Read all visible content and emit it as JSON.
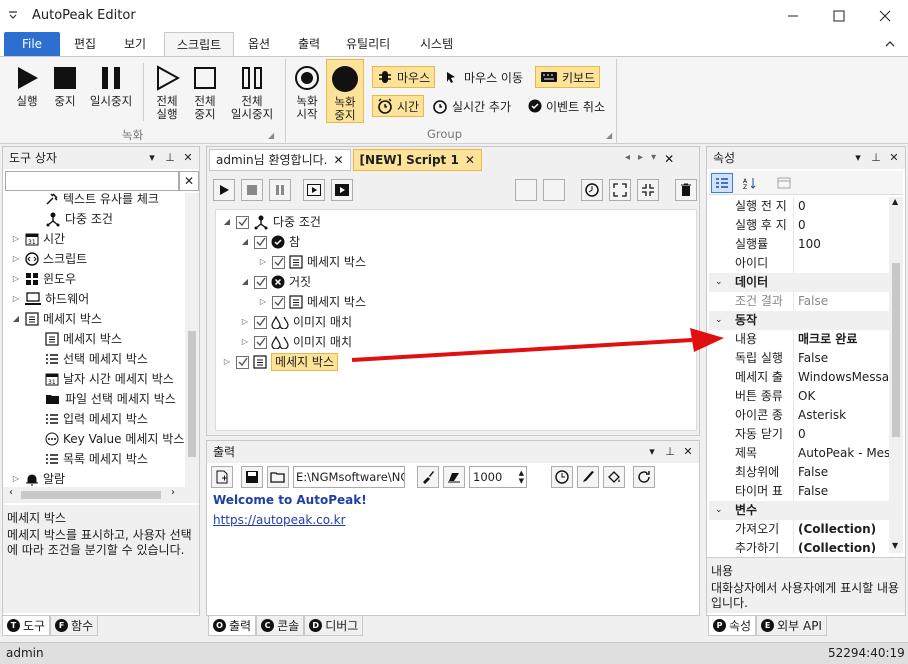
{
  "app": {
    "title": "AutoPeak Editor"
  },
  "menu": {
    "file": "File",
    "tabs": [
      "편집",
      "보기",
      "스크립트",
      "옵션",
      "출력",
      "유틸리티",
      "시스템"
    ]
  },
  "ribbon": {
    "record": [
      "실행",
      "중지",
      "일시중지"
    ],
    "all": [
      [
        "전체",
        "실행"
      ],
      [
        "전체",
        "중지"
      ],
      [
        "전체",
        "일시중지"
      ]
    ],
    "rec": [
      [
        "녹화",
        "시작"
      ],
      [
        "녹화",
        "중지"
      ]
    ],
    "small": {
      "mouse": "마우스",
      "mouse_move": "마우스 이동",
      "keyboard": "키보드",
      "time": "시간",
      "realtime": "실시간 추가",
      "event_cancel": "이벤트 취소"
    },
    "group_record": "녹화",
    "group_group": "Group"
  },
  "toolbox": {
    "title": "도구 상자",
    "items": [
      {
        "t": "텍스트 유사를 체크",
        "i": "similar"
      },
      {
        "t": "다중 조건",
        "i": "multi"
      },
      {
        "t": "시간",
        "i": "cal",
        "e": "▷"
      },
      {
        "t": "스크립트",
        "i": "script",
        "e": "▷"
      },
      {
        "t": "윈도우",
        "i": "win",
        "e": "▷"
      },
      {
        "t": "하드웨어",
        "i": "pc",
        "e": "▷"
      },
      {
        "t": "메세지 박스",
        "i": "msg",
        "e": "◢"
      },
      {
        "t": "메세지 박스",
        "i": "msg",
        "c": 1
      },
      {
        "t": "선택 메세지 박스",
        "i": "list",
        "c": 1
      },
      {
        "t": "날자 시간 메세지 박스",
        "i": "cal",
        "c": 1
      },
      {
        "t": "파일 선택 메세지 박스",
        "i": "folder",
        "c": 1
      },
      {
        "t": "입력 메세지 박스",
        "i": "list",
        "c": 1
      },
      {
        "t": "Key Value 메세지 박스",
        "i": "dots",
        "c": 1
      },
      {
        "t": "목록 메세지 박스",
        "i": "list",
        "c": 1
      },
      {
        "t": "알람",
        "i": "bell",
        "e": "▷"
      }
    ],
    "desc_title": "메세지 박스",
    "desc": "메세지 박스를 표시하고, 사용자 선택에 따라 조건을 분기할 수 있습니다.",
    "tabs": [
      "도구",
      "함수"
    ]
  },
  "doc": {
    "tabs": [
      "admin님 환영합니다.",
      "[NEW] Script 1"
    ]
  },
  "script": [
    {
      "t": "다중 조건",
      "l": 0,
      "e": "◢",
      "i": "multi"
    },
    {
      "t": "참",
      "l": 1,
      "e": "◢",
      "i": "check"
    },
    {
      "t": "메세지 박스",
      "l": 2,
      "e": "▷",
      "i": "msg"
    },
    {
      "t": "거짓",
      "l": 1,
      "e": "◢",
      "i": "x"
    },
    {
      "t": "메세지 박스",
      "l": 2,
      "e": "▷",
      "i": "msg"
    },
    {
      "t": "이미지 매치",
      "l": 1,
      "e": "▷",
      "i": "drops"
    },
    {
      "t": "이미지 매치",
      "l": 1,
      "e": "▷",
      "i": "drops"
    },
    {
      "t": "메세지 박스",
      "l": 0,
      "e": "▷",
      "i": "msg",
      "sel": 1
    }
  ],
  "output": {
    "title": "출력",
    "path": "E:\\NGMsoftware\\NG",
    "count": "1000",
    "welcome": "Welcome to AutoPeak!",
    "link": "https://autopeak.co.kr",
    "tabs": [
      "출력",
      "콘솔",
      "디버그"
    ]
  },
  "props": {
    "title": "속성",
    "rows": [
      {
        "k": "실행 전 지",
        "v": "0"
      },
      {
        "k": "실행 후 지",
        "v": "0"
      },
      {
        "k": "실행률",
        "v": "100"
      },
      {
        "k": "아이디",
        "v": ""
      },
      {
        "cat": "데이터"
      },
      {
        "k": "조건 결과",
        "v": "False",
        "g": 1
      },
      {
        "cat": "동작"
      },
      {
        "k": "내용",
        "v": "매크로 완료",
        "b": 1
      },
      {
        "k": "독립 실행",
        "v": "False"
      },
      {
        "k": "메세지 출",
        "v": "WindowsMessage"
      },
      {
        "k": "버튼 종류",
        "v": "OK"
      },
      {
        "k": "아이콘 종",
        "v": "Asterisk"
      },
      {
        "k": "자동 닫기",
        "v": "0"
      },
      {
        "k": "제목",
        "v": "AutoPeak - Messa"
      },
      {
        "k": "최상위에 ",
        "v": "False"
      },
      {
        "k": "타이머 표",
        "v": "False"
      },
      {
        "cat": "변수"
      },
      {
        "k": "가져오기",
        "v": "(Collection)",
        "b": 1
      },
      {
        "k": "추가하기",
        "v": "(Collection)",
        "b": 1
      }
    ],
    "desc_title": "내용",
    "desc": "대화상자에서 사용자에게 표시할 내용입니다.",
    "tabs": [
      "속성",
      "외부 API"
    ]
  },
  "status": {
    "user": "admin",
    "time": "52294:40:19"
  },
  "colors": {
    "accent": "#2b6fd0",
    "highlight": "#fde39a",
    "arrow": "#e01010"
  }
}
